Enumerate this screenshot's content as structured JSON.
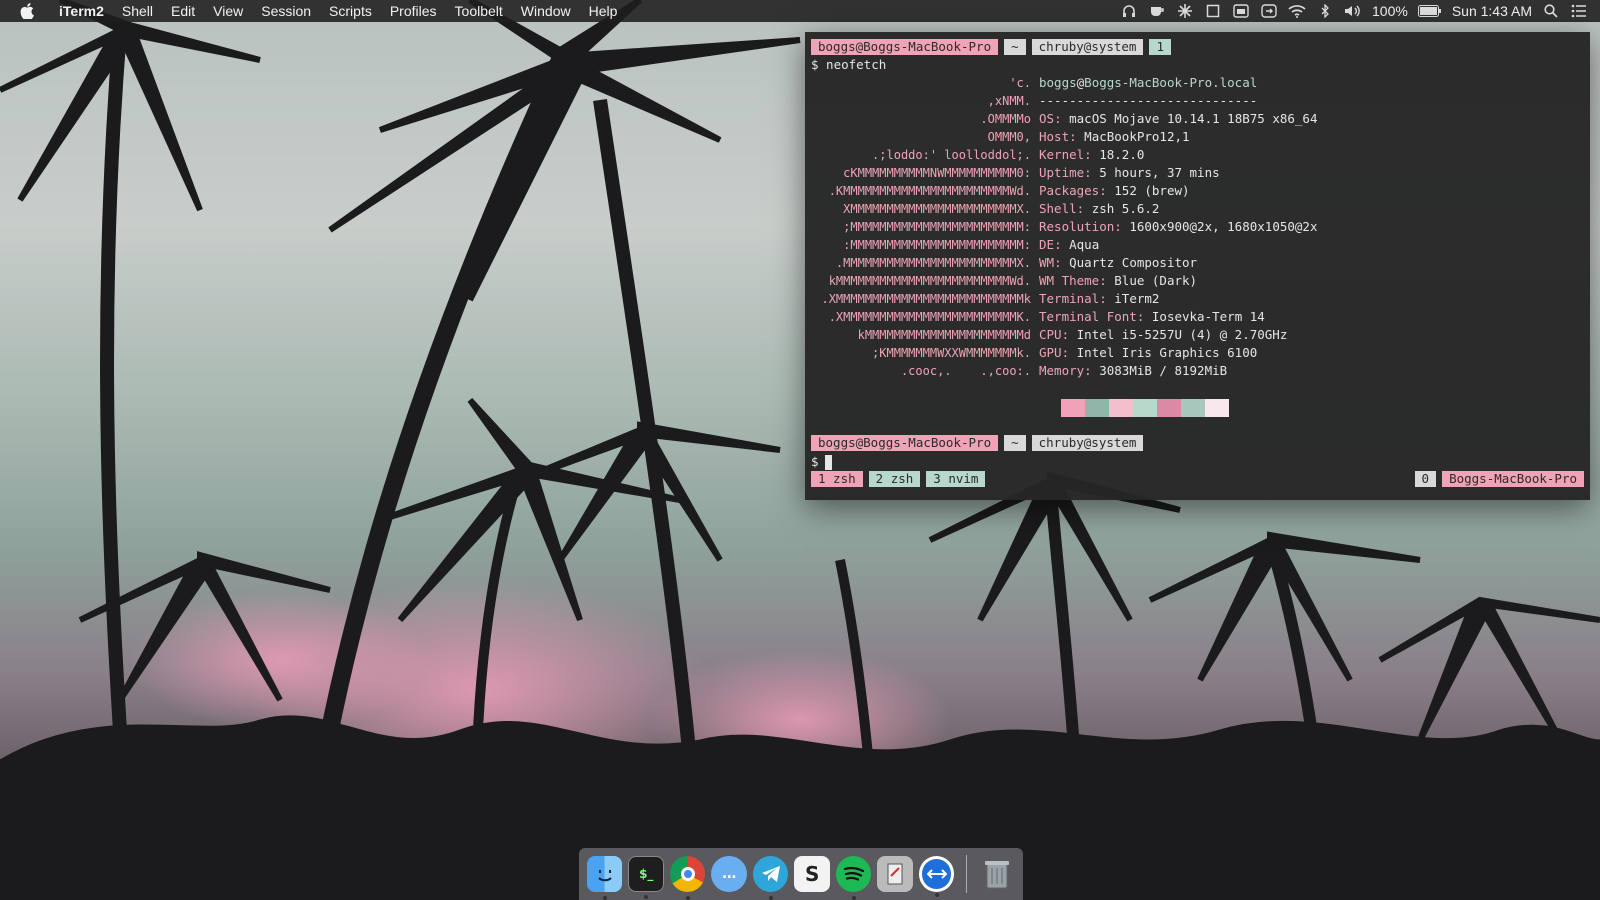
{
  "menubar": {
    "app_name": "iTerm2",
    "items": [
      "Shell",
      "Edit",
      "View",
      "Session",
      "Scripts",
      "Profiles",
      "Toolbelt",
      "Window",
      "Help"
    ],
    "battery": "100%",
    "clock": "Sun 1:43 AM",
    "status_icons": [
      "headphones-icon",
      "cup-icon",
      "snowflake-icon",
      "window-icon",
      "calendar-icon",
      "screen-share-icon",
      "wifi-icon",
      "bluetooth-icon",
      "volume-icon",
      "battery-icon",
      "spotlight-icon",
      "notification-center-icon"
    ]
  },
  "terminal": {
    "prompt1": {
      "host": "boggs@Boggs-MacBook-Pro",
      "dir": "~",
      "ruby": "chruby@system",
      "count": "1"
    },
    "command": "$ neofetch",
    "logo": [
      "'c.",
      ",xNMM.",
      ".OMMMMo",
      "OMMM0,",
      ".;loddo:' loolloddol;.",
      "cKMMMMMMMMMMNWMMMMMMMMMM0:",
      ".KMMMMMMMMMMMMMMMMMMMMMMMWd.",
      "XMMMMMMMMMMMMMMMMMMMMMMMX.",
      ";MMMMMMMMMMMMMMMMMMMMMMMM:",
      ":MMMMMMMMMMMMMMMMMMMMMMMM:",
      ".MMMMMMMMMMMMMMMMMMMMMMMMX.",
      "kMMMMMMMMMMMMMMMMMMMMMMMMWd.",
      ".XMMMMMMMMMMMMMMMMMMMMMMMMMMk",
      ".XMMMMMMMMMMMMMMMMMMMMMMMMK.",
      "kMMMMMMMMMMMMMMMMMMMMMMd",
      ";KMMMMMMMWXXWMMMMMMMk.",
      ".cooc,.    .,coo:."
    ],
    "user": "boggs",
    "at": "@",
    "hostname": "Boggs-MacBook-Pro.local",
    "separator": "-----------------------------",
    "info": [
      {
        "key": "OS",
        "value": "macOS Mojave 10.14.1 18B75 x86_64"
      },
      {
        "key": "Host",
        "value": "MacBookPro12,1"
      },
      {
        "key": "Kernel",
        "value": "18.2.0"
      },
      {
        "key": "Uptime",
        "value": "5 hours, 37 mins"
      },
      {
        "key": "Packages",
        "value": "152 (brew)"
      },
      {
        "key": "Shell",
        "value": "zsh 5.6.2"
      },
      {
        "key": "Resolution",
        "value": "1600x900@2x, 1680x1050@2x"
      },
      {
        "key": "DE",
        "value": "Aqua"
      },
      {
        "key": "WM",
        "value": "Quartz Compositor"
      },
      {
        "key": "WM Theme",
        "value": "Blue (Dark)"
      },
      {
        "key": "Terminal",
        "value": "iTerm2"
      },
      {
        "key": "Terminal Font",
        "value": "Iosevka-Term 14"
      },
      {
        "key": "CPU",
        "value": "Intel i5-5257U (4) @ 2.70GHz"
      },
      {
        "key": "GPU",
        "value": "Intel Iris Graphics 6100"
      },
      {
        "key": "Memory",
        "value": "3083MiB / 8192MiB"
      }
    ],
    "palette_colors": [
      "#f0a3b6",
      "#8fb5a8",
      "#f3bfcb",
      "#b8d8cc",
      "#d98aa5",
      "#a7c7bd",
      "#f8e8ee"
    ],
    "prompt2": {
      "host": "boggs@Boggs-MacBook-Pro",
      "dir": "~",
      "ruby": "chruby@system"
    },
    "prompt_symbol": "$",
    "tmux": {
      "windows": [
        "1 zsh",
        "2 zsh",
        "3 nvim"
      ],
      "session": "0",
      "host": "Boggs-MacBook-Pro"
    }
  },
  "dock": {
    "apps": [
      "finder-icon",
      "terminal-icon",
      "chrome-icon",
      "messenger-icon",
      "telegram-icon",
      "sublime-icon",
      "spotify-icon",
      "script-editor-icon",
      "teamviewer-icon"
    ],
    "trash": "trash-icon"
  }
}
